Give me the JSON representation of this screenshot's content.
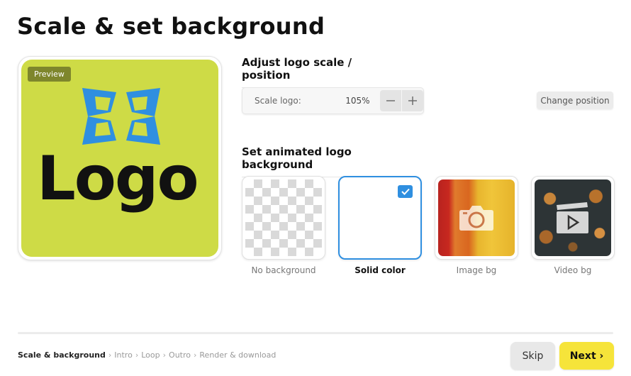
{
  "page": {
    "title": "Scale & set background"
  },
  "preview": {
    "badge": "Preview",
    "logo_text": "Logo",
    "background_color": "#cedb46",
    "logo_mark_color": "#2f8fe0"
  },
  "scale_section": {
    "heading": "Adjust logo scale / position",
    "scale_label": "Scale logo:",
    "scale_value": "105%",
    "decrease_icon": "minus-icon",
    "increase_icon": "plus-icon",
    "change_position_label": "Change position"
  },
  "background_section": {
    "heading": "Set animated logo background",
    "options": [
      {
        "label": "No background",
        "selected": false
      },
      {
        "label": "Solid color",
        "selected": true
      },
      {
        "label": "Image bg",
        "selected": false,
        "icon": "camera-icon"
      },
      {
        "label": "Video bg",
        "selected": false,
        "icon": "video-icon"
      }
    ],
    "selected_color": "#2f8fe0"
  },
  "footer": {
    "breadcrumb": [
      {
        "label": "Scale & background",
        "current": true
      },
      {
        "label": "Intro",
        "current": false
      },
      {
        "label": "Loop",
        "current": false
      },
      {
        "label": "Outro",
        "current": false
      },
      {
        "label": "Render & download",
        "current": false
      }
    ],
    "separator": "›",
    "skip_label": "Skip",
    "next_label": "Next ›",
    "next_color": "#f6e43a"
  }
}
